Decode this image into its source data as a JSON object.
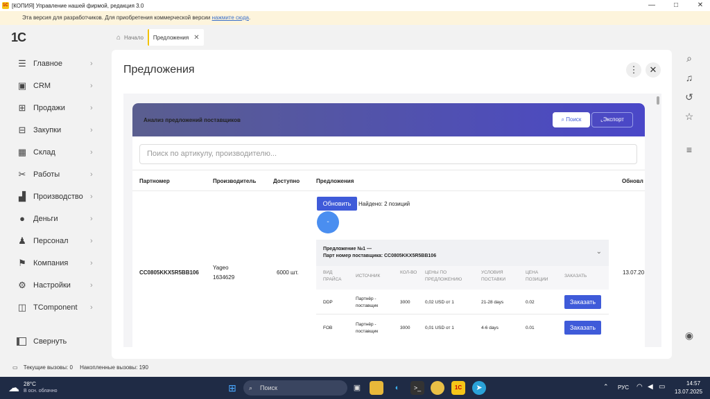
{
  "window": {
    "title": "[КОПИЯ] Управление нашей фирмой, редакция 3.0",
    "app_icon": "1С",
    "controls": [
      "—",
      "□",
      "✕"
    ]
  },
  "devbar": {
    "text": "Эта версия для разработчиков. Для приобретения коммерческой версии",
    "link": "нажмите сюда",
    "tail": "."
  },
  "logo": "1С",
  "tabs": [
    {
      "label": "Начало"
    },
    {
      "label": "Предложения"
    }
  ],
  "sidebar": {
    "items": [
      {
        "label": "Главное",
        "icon": "menu-icon",
        "glyph": "☰"
      },
      {
        "label": "CRM",
        "icon": "crm-icon",
        "glyph": "▣"
      },
      {
        "label": "Продажи",
        "icon": "basket-icon",
        "glyph": "⊞"
      },
      {
        "label": "Закупки",
        "icon": "cart-icon",
        "glyph": "⊟"
      },
      {
        "label": "Склад",
        "icon": "warehouse-icon",
        "glyph": "▦"
      },
      {
        "label": "Работы",
        "icon": "tools-icon",
        "glyph": "✂"
      },
      {
        "label": "Производство",
        "icon": "factory-icon",
        "glyph": "▟"
      },
      {
        "label": "Деньги",
        "icon": "money-icon",
        "glyph": "●"
      },
      {
        "label": "Персонал",
        "icon": "person-icon",
        "glyph": "♟"
      },
      {
        "label": "Компания",
        "icon": "flag-icon",
        "glyph": "⚑"
      },
      {
        "label": "Настройки",
        "icon": "gear-icon",
        "glyph": "⚙"
      },
      {
        "label": "TComponent",
        "icon": "component-icon",
        "glyph": "◫"
      }
    ],
    "collapse": "Свернуть"
  },
  "panel": {
    "title": "Предложения",
    "card": {
      "title": "Анализ предложений поставщиков",
      "search_btn": "Поиск",
      "export_btn": "Экспорт",
      "search_placeholder": "Поиск по артикулу, производителю...",
      "columns": [
        "Партномер",
        "Производитель",
        "Доступно",
        "Предложения",
        "Обновл"
      ],
      "row": {
        "partnumber": "CC0805KKX5R5BB106",
        "manufacturer": "Yageo",
        "manufacturer_code": "1634629",
        "available": "6000 шт.",
        "update_btn": "Обновить",
        "found": "Найдено: 2 позиций",
        "circle": "-",
        "updated": "13.07.20",
        "offer_title": "Предложение №1 —",
        "offer_sub": "Парт номер поставщика: CC0805KKX5R5BB106",
        "sub_headers": [
          "ВИД ПРАЙСА",
          "ИСТОЧНИК",
          "КОЛ-ВО",
          "ЦЕНЫ ПО ПРЕДЛОЖЕНИЮ",
          "УСЛОВИЯ ПОСТАВКИ",
          "ЦЕНА ПОЗИЦИИ",
          "ЗАКАЗАТЬ"
        ],
        "sub_rows": [
          {
            "type": "DDP",
            "source": "Партнёр - поставщик",
            "qty": "3000",
            "price": "0,02 USD от 1",
            "terms": "21-28 days",
            "unit": "0.02",
            "btn": "Заказать"
          },
          {
            "type": "FOB",
            "source": "Партнёр - поставщик",
            "qty": "3000",
            "price": "0,01 USD от 1",
            "terms": "4-6 days",
            "unit": "0.01",
            "btn": "Заказать"
          }
        ]
      }
    }
  },
  "status": {
    "current": "Текущие вызовы: 0",
    "accumulated": "Накопленные вызовы: 190"
  },
  "taskbar": {
    "temp": "28°C",
    "weather": "В осн. облачно",
    "search": "Поиск",
    "lang": "РУС",
    "time": "14:57",
    "date": "13.07.2025"
  }
}
